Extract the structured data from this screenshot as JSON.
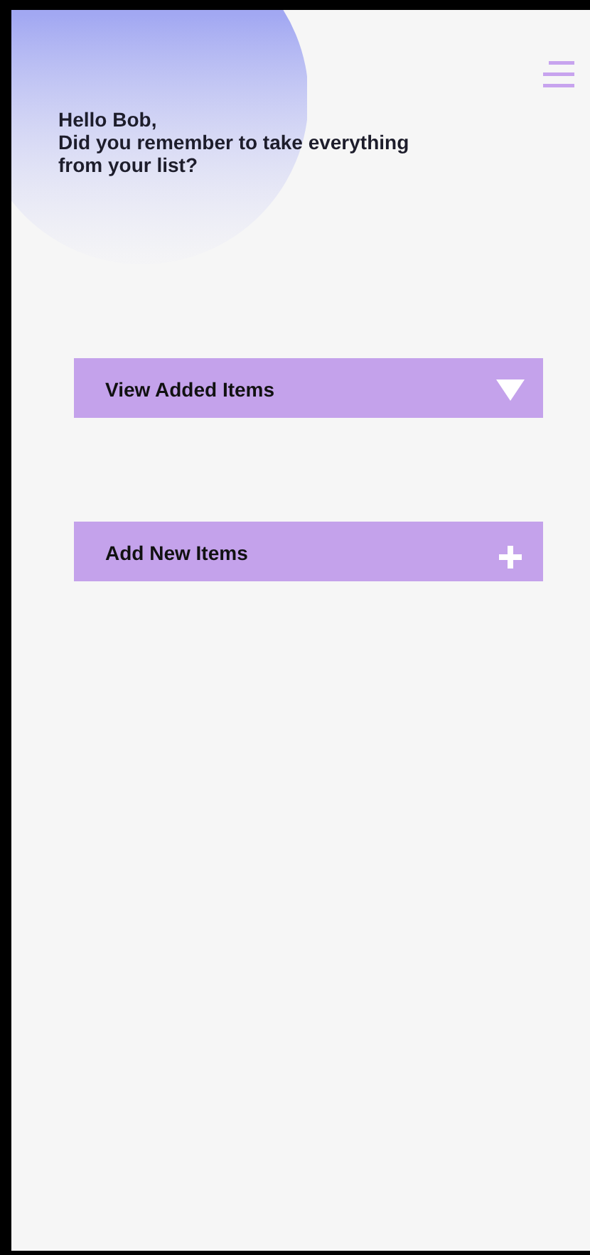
{
  "greeting": {
    "name_line": "Hello Bob,",
    "question": "Did you remember to take everything from your list?"
  },
  "actions": [
    {
      "label": "View Added Items",
      "kind": "expand"
    },
    {
      "label": "Add New Items",
      "kind": "add"
    }
  ]
}
